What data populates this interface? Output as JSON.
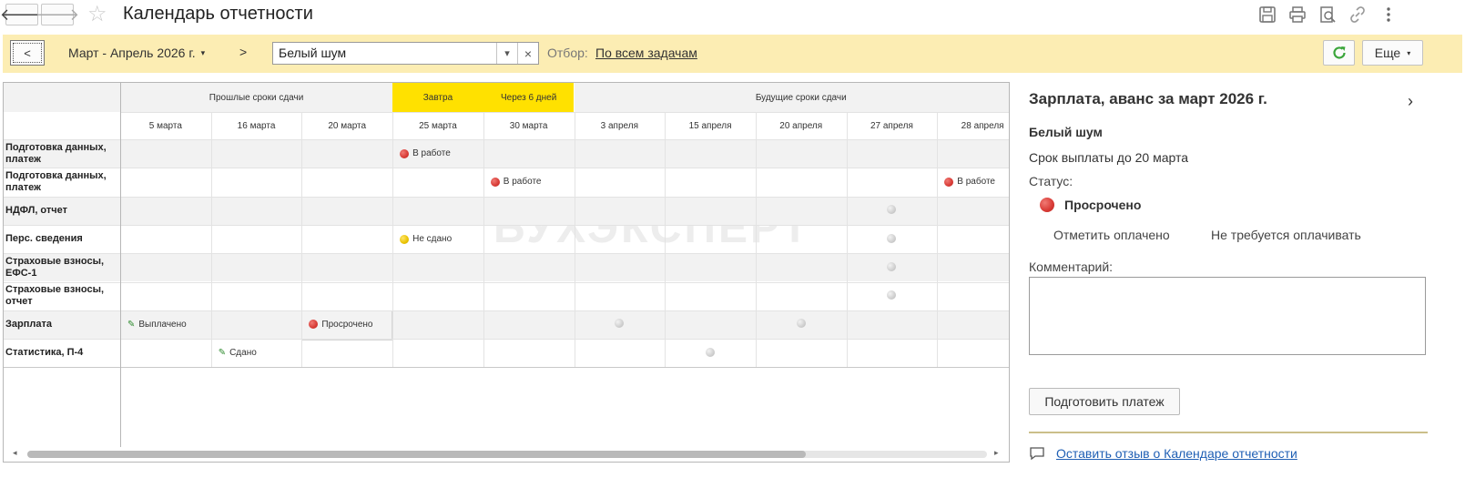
{
  "window": {
    "title": "Календарь отчетности",
    "back_glyph": "🡐",
    "forward_glyph": "🡒",
    "favorite_glyph": "☆",
    "icons": [
      "save-icon",
      "print-icon",
      "preview-icon",
      "link-icon",
      "more-vert-icon"
    ]
  },
  "toolbar": {
    "prev_label": "<",
    "period_label": "Март - Апрель 2026 г.",
    "period_caret": "▾",
    "next_label": ">",
    "organization_value": "Белый шум",
    "organization_dropdown_glyph": "▾",
    "organization_clear_glyph": "×",
    "filter_label": "Отбор:",
    "filter_value": "По всем задачам",
    "more_label": "Еще",
    "more_caret": "▾",
    "colors": {
      "background": "#fcedb3",
      "refresh": "#3aa53a"
    }
  },
  "calendar": {
    "watermark": "БУХЭКСПЕРТ",
    "groups": [
      {
        "label": "Прошлые сроки сдачи",
        "highlight": false
      },
      {
        "label": "Завтра",
        "highlight": true
      },
      {
        "label": "Через 6 дней",
        "highlight": true
      },
      {
        "label": "Будущие сроки сдачи",
        "highlight": false
      }
    ],
    "dates": [
      "5 марта",
      "16 марта",
      "20 марта",
      "25 марта",
      "30 марта",
      "3 апреля",
      "15 апреля",
      "20 апреля",
      "27 апреля",
      "28 апреля"
    ],
    "rows": [
      {
        "label": "Подготовка данных, платеж",
        "cells": [
          {
            "col": 3,
            "kind": "red",
            "text": "В работе"
          }
        ]
      },
      {
        "label": "Подготовка данных, платеж",
        "cells": [
          {
            "col": 4,
            "kind": "red",
            "text": "В работе"
          },
          {
            "col": 9,
            "kind": "red",
            "text": "В работе"
          }
        ]
      },
      {
        "label": "НДФЛ, отчет",
        "cells": [
          {
            "col": 8,
            "kind": "gray",
            "text": ""
          }
        ]
      },
      {
        "label": "Перс. сведения",
        "cells": [
          {
            "col": 3,
            "kind": "yellow",
            "text": "Не сдано"
          },
          {
            "col": 8,
            "kind": "gray",
            "text": ""
          }
        ]
      },
      {
        "label": "Страховые взносы, ЕФС-1",
        "cells": [
          {
            "col": 8,
            "kind": "gray",
            "text": ""
          }
        ]
      },
      {
        "label": "Страховые взносы, отчет",
        "cells": [
          {
            "col": 8,
            "kind": "gray",
            "text": ""
          }
        ]
      },
      {
        "label": "Зарплата",
        "cells": [
          {
            "col": 0,
            "kind": "pencil",
            "text": "Выплачено"
          },
          {
            "col": 2,
            "kind": "red",
            "text": "Просрочено",
            "selected": true
          },
          {
            "col": 5,
            "kind": "gray",
            "text": ""
          },
          {
            "col": 7,
            "kind": "gray",
            "text": ""
          }
        ]
      },
      {
        "label": "Статистика, П-4",
        "cells": [
          {
            "col": 1,
            "kind": "pencil",
            "text": "Сдано"
          },
          {
            "col": 6,
            "kind": "gray",
            "text": ""
          }
        ]
      }
    ],
    "scroll_left_glyph": "◂",
    "scroll_right_glyph": "▸",
    "colors": {
      "highlight_header": "#ffe100",
      "group_header": "#f2f2f2",
      "row_stripe": "#f2f2f2"
    }
  },
  "detail": {
    "title": "Зарплата, аванс за март 2026 г.",
    "chevron_glyph": "›",
    "organization": "Белый шум",
    "due": "Срок выплаты до 20 марта",
    "status_label": "Статус:",
    "status_value": "Просрочено",
    "action_mark_paid": "Отметить оплачено",
    "action_not_required": "Не требуется оплачивать",
    "comment_label": "Комментарий:",
    "comment_value": "",
    "prepare_payment_label": "Подготовить платеж",
    "feedback_link": "Оставить отзыв о Календаре отчетности",
    "colors": {
      "status": "#d83a35",
      "link": "#1f5fb4"
    }
  }
}
